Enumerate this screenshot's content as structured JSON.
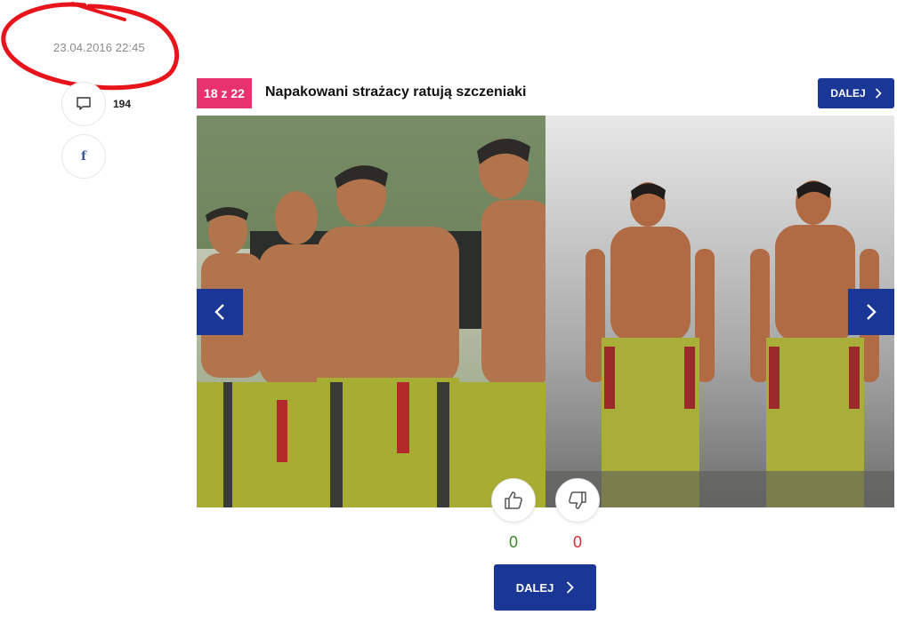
{
  "meta": {
    "timestamp": "23.04.2016 22:45"
  },
  "social": {
    "comments_icon": "comment-icon",
    "comment_count": "194",
    "facebook_icon": "facebook-icon",
    "facebook_glyph": "f"
  },
  "gallery": {
    "counter": "18 z 22",
    "title": "Napakowani strażacy ratują szczeniaki",
    "next_label": "DALEJ",
    "prev_arrow_icon": "chevron-left-icon",
    "next_arrow_icon": "chevron-right-icon"
  },
  "votes": {
    "up_icon": "thumbs-up-icon",
    "down_icon": "thumbs-down-icon",
    "up_count": "0",
    "down_count": "0"
  },
  "footer": {
    "next_label": "DALEJ"
  },
  "colors": {
    "accent_blue": "#1a3796",
    "badge_pink": "#e8316f",
    "annotation_red": "#e8141b",
    "upvote_green": "#3a8a2a",
    "downvote_red": "#d03030"
  }
}
